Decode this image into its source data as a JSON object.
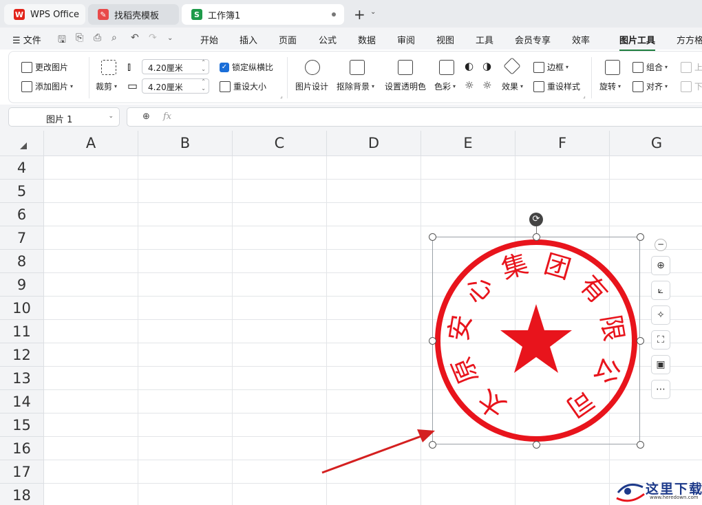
{
  "tabs": [
    {
      "label": "WPS Office"
    },
    {
      "label": "找稻壳模板"
    },
    {
      "label": "工作簿1"
    }
  ],
  "menu": {
    "file": "文件",
    "items": [
      "开始",
      "插入",
      "页面",
      "公式",
      "数据",
      "审阅",
      "视图",
      "工具",
      "会员专享",
      "效率",
      "图片工具",
      "方方格"
    ]
  },
  "ribbon": {
    "change_picture": "更改图片",
    "add_picture": "添加图片",
    "crop": "裁剪",
    "height_value": "4.20厘米",
    "width_value": "4.20厘米",
    "lock_ratio": "锁定纵横比",
    "reset_size": "重设大小",
    "picture_design": "图片设计",
    "remove_bg": "抠除背景",
    "set_transparent": "设置透明色",
    "color": "色彩",
    "effects": "效果",
    "border": "边框",
    "reset_style": "重设样式",
    "rotate": "旋转",
    "group": "组合",
    "align": "对齐",
    "up": "上",
    "down": "下"
  },
  "formula_bar": {
    "name_box": "图片 1",
    "fx": "fx"
  },
  "columns": [
    "A",
    "B",
    "C",
    "D",
    "E",
    "F",
    "G"
  ],
  "rows": [
    "4",
    "5",
    "6",
    "7",
    "8",
    "9",
    "10",
    "11",
    "12",
    "13",
    "14",
    "15",
    "16",
    "17",
    "18"
  ],
  "seal": {
    "text": "太原安心集团有限公司",
    "color": "#e8141c"
  },
  "watermark": {
    "text": "这里下载",
    "url": "www.heredown.com"
  },
  "colors": {
    "accent_green": "#1e7e3e",
    "checkbox_blue": "#1a6ed8",
    "arrow_red": "#d42020"
  }
}
